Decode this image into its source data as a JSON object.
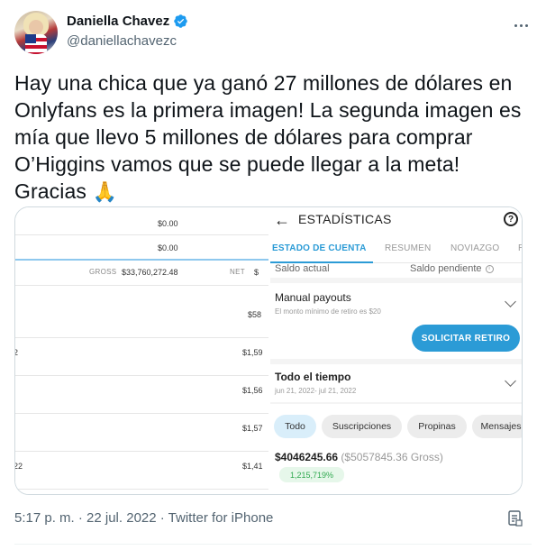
{
  "author": {
    "name": "Daniella Chavez",
    "handle": "@daniellachavezc",
    "verified": true
  },
  "tweet": {
    "text": "Hay una chica que ya ganó 27 millones de dólares en Onlyfans es la primera imagen! La segunda imagen es mía que llevo 5 millones de dólares para comprar O’Higgins vamos que se puede llegar a la meta! Gracias",
    "emoji": "🙏",
    "timestamp": "5:17 p. m. · 22 jul. 2022 · Twitter for iPhone"
  },
  "image_left": {
    "rows": [
      {
        "value": "$0.00"
      },
      {
        "value": "$0.00"
      }
    ],
    "gross_label": "GROSS",
    "gross_value": "$33,760,272.48",
    "net_label": "NET",
    "net_value": "$",
    "list": [
      {
        "left": "",
        "right": "$58"
      },
      {
        "left": "2",
        "right": "$1,59"
      },
      {
        "left": "",
        "right": "$1,56"
      },
      {
        "left": "",
        "right": "$1,57"
      },
      {
        "left": "22",
        "right": "$1,41"
      }
    ]
  },
  "image_right": {
    "title": "ESTADÍSTICAS",
    "tabs": [
      "ESTADO DE CUENTA",
      "RESUMEN",
      "NOVIAZGO",
      "R"
    ],
    "saldo_actual": "Saldo actual",
    "saldo_pendiente": "Saldo pendiente",
    "manual_payouts": "Manual payouts",
    "minimum_note": "El monto mínimo de retiro es $20",
    "withdraw_button": "SOLICITAR RETIRO",
    "period_title": "Todo el tiempo",
    "period_range": "jun 21, 2022- jul  21, 2022",
    "chips": [
      "Todo",
      "Suscripciones",
      "Propinas",
      "Mensajes"
    ],
    "amount_net": "$4046245.66",
    "amount_gross": "($5057845.36 Gross)",
    "percent": "1,215,719%"
  },
  "colors": {
    "accent": "#2b9bd6",
    "verified": "#1d9bf0",
    "text_secondary": "#536471"
  }
}
